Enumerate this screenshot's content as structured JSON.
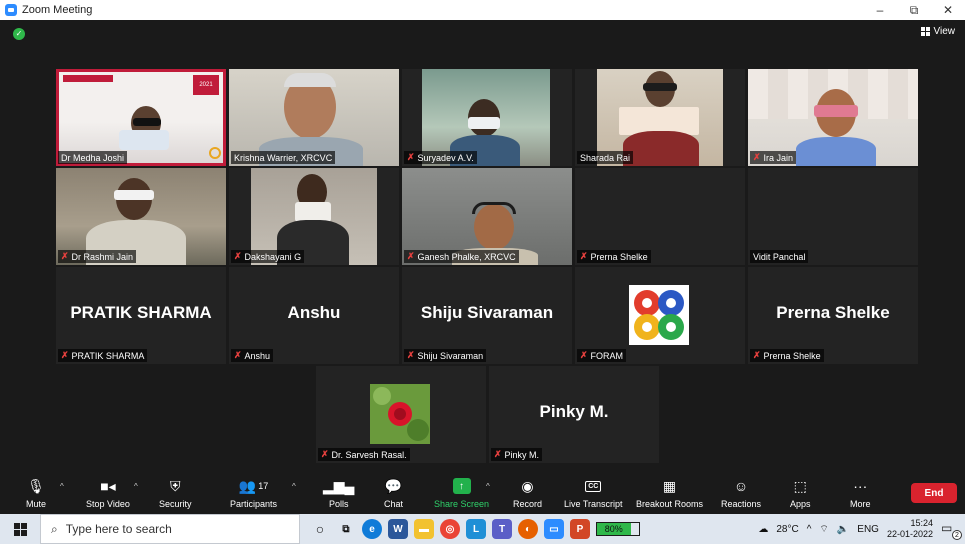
{
  "window": {
    "title": "Zoom Meeting",
    "minimize": "–",
    "maximize": "⧉",
    "close": "✕"
  },
  "view_label": "View",
  "participants": [
    {
      "name": "Dr Medha Joshi",
      "muted": false
    },
    {
      "name": "Krishna Warrier, XRCVC",
      "muted": false
    },
    {
      "name": "Suryadev A.V.",
      "muted": true
    },
    {
      "name": "Sharada Rai",
      "muted": false
    },
    {
      "name": "Ira Jain",
      "muted": true
    },
    {
      "name": "Dr Rashmi Jain",
      "muted": true
    },
    {
      "name": "Dakshayani G",
      "muted": true
    },
    {
      "name": "Ganesh Phalke, XRCVC",
      "muted": true
    },
    {
      "name": "Prerna Shelke",
      "muted": true
    },
    {
      "name": "Vidit Panchal",
      "muted": false
    },
    {
      "name": "PRATIK SHARMA",
      "display": "PRATIK SHARMA",
      "muted": true
    },
    {
      "name": "Anshu",
      "display": "Anshu",
      "muted": true
    },
    {
      "name": "Shiju Sivaraman",
      "display": "Shiju Sivaraman",
      "muted": true
    },
    {
      "name": "FORAM",
      "muted": true
    },
    {
      "name": "Prerna Shelke",
      "display": "Prerna Shelke",
      "muted": true
    },
    {
      "name": "Dr. Sarvesh Rasal.",
      "muted": true
    },
    {
      "name": "Pinky M.",
      "display": "Pinky M.",
      "muted": true
    }
  ],
  "slide_badge": "2021",
  "toolbar": {
    "mute": "Mute",
    "stop_video": "Stop Video",
    "security": "Security",
    "participants": "Participants",
    "participants_count": "17",
    "polls": "Polls",
    "chat": "Chat",
    "share_screen": "Share Screen",
    "record": "Record",
    "live_transcript": "Live Transcript",
    "cc": "CC",
    "breakout_rooms": "Breakout Rooms",
    "reactions": "Reactions",
    "apps": "Apps",
    "more": "More",
    "end": "End"
  },
  "taskbar": {
    "search_placeholder": "Type here to search",
    "battery": "80%",
    "temperature": "28°C",
    "language": "ENG",
    "time": "15:24",
    "date": "22-01-2022",
    "notifications": "2"
  },
  "colors": {
    "end_red": "#d9232e",
    "share_green": "#22b14c",
    "muted_red": "#e5403e",
    "active_speaker": "#d9e84a"
  }
}
